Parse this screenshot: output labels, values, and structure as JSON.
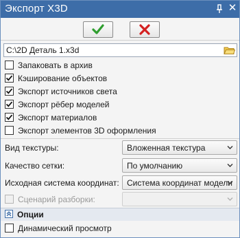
{
  "window": {
    "title": "Экспорт X3D",
    "pin_icon": "pin-icon",
    "close_icon": "close-icon"
  },
  "toolbar": {
    "ok_icon": "green-checkmark-icon",
    "cancel_icon": "red-x-icon",
    "ok_color": "#2f9e2f",
    "cancel_color": "#d42020"
  },
  "file": {
    "path": "C:\\2D Деталь 1.x3d",
    "browse_icon": "folder-icon"
  },
  "checkboxes": [
    {
      "label": "Запаковать в архив",
      "checked": false
    },
    {
      "label": "Кэширование объектов",
      "checked": true
    },
    {
      "label": "Экспорт источников света",
      "checked": true
    },
    {
      "label": "Экспорт рёбер моделей",
      "checked": true
    },
    {
      "label": "Экспорт материалов",
      "checked": true
    },
    {
      "label": "Экспорт элементов 3D оформления",
      "checked": false
    }
  ],
  "fields": {
    "texture_label": "Вид текстуры:",
    "texture_value": "Вложенная текстура",
    "mesh_label": "Качество сетки:",
    "mesh_value": "По умолчанию",
    "coord_label": "Исходная система координат:",
    "coord_value": "Система координат модели",
    "scenario_label": "Сценарий разборки:",
    "scenario_checked": false,
    "scenario_value": ""
  },
  "options": {
    "title": "Опции",
    "expand_icon": "collapse-up-icon",
    "dynamic_view_label": "Динамический просмотр",
    "dynamic_view_checked": false
  }
}
